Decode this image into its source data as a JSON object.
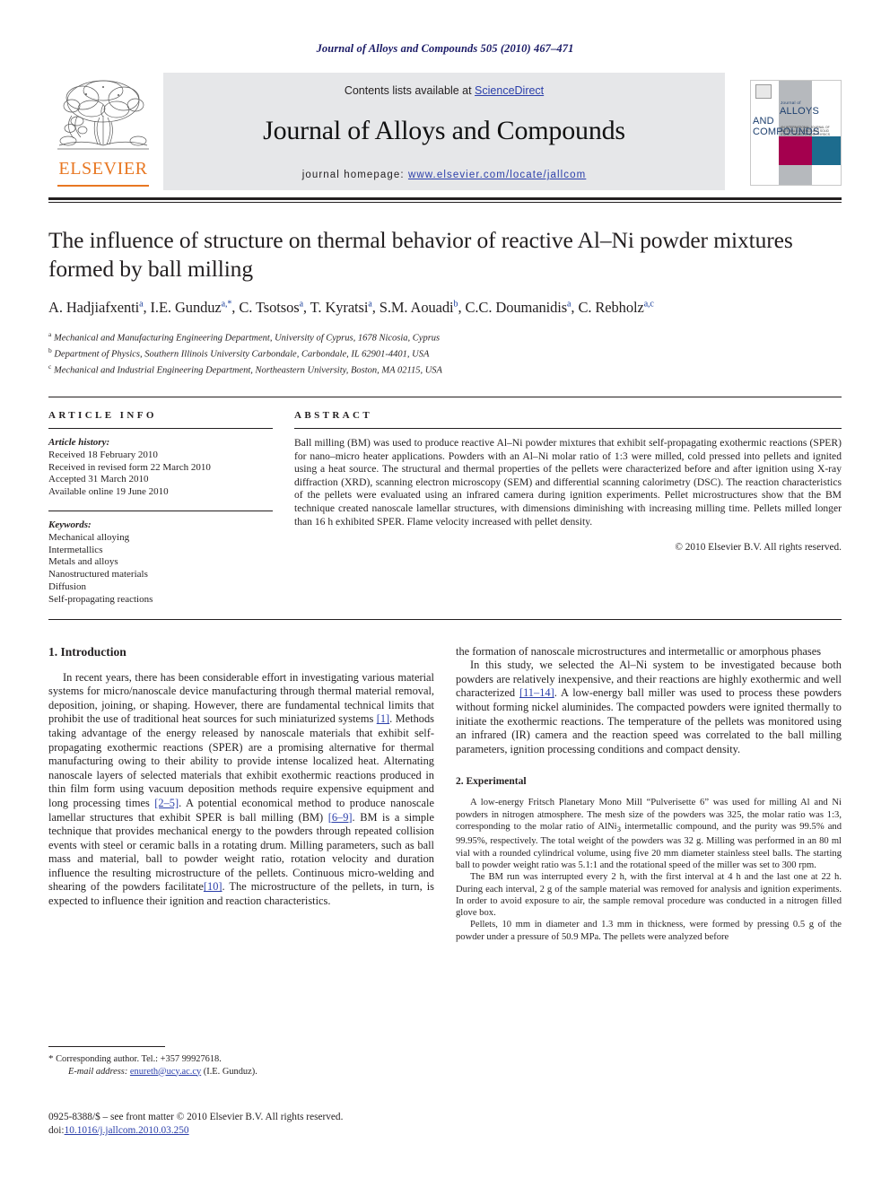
{
  "running_head": "Journal of Alloys and Compounds 505 (2010) 467–471",
  "masthead": {
    "contents_prefix": "Contents lists available at ",
    "sciencedirect": "ScienceDirect",
    "journal_name": "Journal of Alloys and Compounds",
    "homepage_prefix": "journal homepage: ",
    "homepage_url": "www.elsevier.com/locate/jallcom",
    "publisher_logo_text": "ELSEVIER",
    "accent_orange": "#e87722",
    "link_blue": "#2b3faa",
    "band_gray": "#e6e7e9"
  },
  "cover_thumb": {
    "line1": "Journal of",
    "line2": "ALLOYS",
    "line3": "AND COMPOUNDS",
    "subtitle": "AN INTERNATIONAL JOURNAL OF MATERIALS SCIENCE AND SOLID STATE CHEMISTRY AND PHYSICS",
    "color_magenta": "#a4004e",
    "color_teal": "#1d6c8e",
    "color_gray": "#b6b9bd"
  },
  "article": {
    "title": "The influence of structure on thermal behavior of reactive Al–Ni powder mixtures formed by ball milling",
    "authors_html": "A. Hadjiafxenti<sup>a</sup>, I.E. Gunduz<sup>a,*</sup>, C. Tsotsos<sup>a</sup>, T. Kyratsi<sup>a</sup>, S.M. Aouadi<sup>b</sup>, C.C. Doumanidis<sup>a</sup>, C. Rebholz<sup>a,c</sup>",
    "affiliations": [
      {
        "marker": "a",
        "text": "Mechanical and Manufacturing Engineering Department, University of Cyprus, 1678 Nicosia, Cyprus"
      },
      {
        "marker": "b",
        "text": "Department of Physics, Southern Illinois University Carbondale, Carbondale, IL 62901-4401, USA"
      },
      {
        "marker": "c",
        "text": "Mechanical and Industrial Engineering Department, Northeastern University, Boston, MA 02115, USA"
      }
    ]
  },
  "article_info": {
    "heading": "ARTICLE INFO",
    "history_label": "Article history:",
    "history": [
      "Received 18 February 2010",
      "Received in revised form 22 March 2010",
      "Accepted 31 March 2010",
      "Available online 19 June 2010"
    ],
    "keywords_label": "Keywords:",
    "keywords": [
      "Mechanical alloying",
      "Intermetallics",
      "Metals and alloys",
      "Nanostructured materials",
      "Diffusion",
      "Self-propagating reactions"
    ]
  },
  "abstract": {
    "heading": "ABSTRACT",
    "text": "Ball milling (BM) was used to produce reactive Al–Ni powder mixtures that exhibit self-propagating exothermic reactions (SPER) for nano–micro heater applications. Powders with an Al–Ni molar ratio of 1:3 were milled, cold pressed into pellets and ignited using a heat source. The structural and thermal properties of the pellets were characterized before and after ignition using X-ray diffraction (XRD), scanning electron microscopy (SEM) and differential scanning calorimetry (DSC). The reaction characteristics of the pellets were evaluated using an infrared camera during ignition experiments. Pellet microstructures show that the BM technique created nanoscale lamellar structures, with dimensions diminishing with increasing milling time. Pellets milled longer than 16 h exhibited SPER. Flame velocity increased with pellet density.",
    "copyright": "© 2010 Elsevier B.V. All rights reserved."
  },
  "sections": {
    "introduction": {
      "heading": "1. Introduction",
      "paragraph1_part1": "In recent years, there has been considerable effort in investigating various material systems for micro/nanoscale device manufacturing through thermal material removal, deposition, joining, or shaping. However, there are fundamental technical limits that prohibit the use of traditional heat sources for such miniaturized systems ",
      "cite1": "[1]",
      "paragraph1_part2": ". Methods taking advantage of the energy released by nanoscale materials that exhibit self-propagating exothermic reactions (SPER) are a promising alternative for thermal manufacturing owing to their ability to provide intense localized heat. Alternating nanoscale layers of selected materials that exhibit exothermic reactions produced in thin film form using vacuum deposition methods require expensive equipment and long processing times ",
      "cite2": "[2–5]",
      "paragraph1_part3": ". A potential economical method to produce nanoscale lamellar structures that exhibit SPER is ball milling (BM) ",
      "cite3": "[6–9]",
      "paragraph1_part4": ". BM is a simple technique that provides mechanical energy to the powders through repeated collision events with steel or ceramic balls in a rotating drum. Milling parameters, such as ball mass and material, ball to powder weight ratio, rotation velocity and duration influence the resulting microstructure of the pellets. Continuous micro-welding and shearing of the powders facilitate the formation of nanoscale microstructures and intermetallic or amorphous phases ",
      "cite4": "[10]",
      "paragraph1_part5": ". The microstructure of the pellets, in turn, is expected to influence their ignition and reaction characteristics.",
      "paragraph2_part1": "In this study, we selected the Al–Ni system to be investigated because both powders are relatively inexpensive, and their reactions are highly exothermic and well characterized ",
      "cite5": "[11–14]",
      "paragraph2_part2": ". A low-energy ball miller was used to process these powders without forming nickel aluminides. The compacted powders were ignited thermally to initiate the exothermic reactions. The temperature of the pellets was monitored using an infrared (IR) camera and the reaction speed was correlated to the ball milling parameters, ignition processing conditions and compact density."
    },
    "experimental": {
      "heading": "2. Experimental",
      "paragraph1": "A low-energy Fritsch Planetary Mono Mill “Pulverisette 6” was used for milling Al and Ni powders in nitrogen atmosphere. The mesh size of the powders was 325, the molar ratio was 1:3, corresponding to the molar ratio of AlNi3 intermetallic compound, and the purity was 99.5% and 99.95%, respectively. The total weight of the powders was 32 g. Milling was performed in an 80 ml vial with a rounded cylindrical volume, using five 20 mm diameter stainless steel balls. The starting ball to powder weight ratio was 5.1:1 and the rotational speed of the miller was set to 300 rpm.",
      "paragraph2": "The BM run was interrupted every 2 h, with the first interval at 4 h and the last one at 22 h. During each interval, 2 g of the sample material was removed for analysis and ignition experiments. In order to avoid exposure to air, the sample removal procedure was conducted in a nitrogen filled glove box.",
      "paragraph3": "Pellets, 10 mm in diameter and 1.3 mm in thickness, were formed by pressing 0.5 g of the powder under a pressure of 50.9 MPa. The pellets were analyzed before"
    }
  },
  "footnotes": {
    "corresponding_marker": "*",
    "corresponding_text": "Corresponding author. Tel.: +357 99927618.",
    "email_label": "E-mail address:",
    "email": "enureth@ucy.ac.cy",
    "email_suffix": "(I.E. Gunduz)."
  },
  "footer": {
    "issn_line": "0925-8388/$ – see front matter © 2010 Elsevier B.V. All rights reserved.",
    "doi_label": "doi:",
    "doi_value": "10.1016/j.jallcom.2010.03.250"
  }
}
